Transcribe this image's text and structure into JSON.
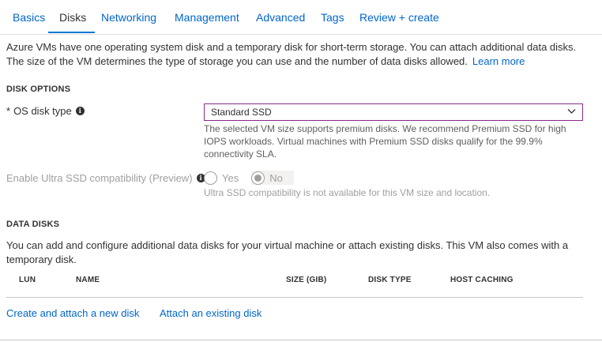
{
  "tabs": [
    {
      "label": "Basics",
      "active": false
    },
    {
      "label": "Disks",
      "active": true
    },
    {
      "label": "Networking",
      "active": false
    },
    {
      "label": "Management",
      "active": false
    },
    {
      "label": "Advanced",
      "active": false
    },
    {
      "label": "Tags",
      "active": false
    },
    {
      "label": "Review + create",
      "active": false
    }
  ],
  "intro": {
    "text": "Azure VMs have one operating system disk and a temporary disk for short-term storage. You can attach additional data disks. The size of the VM determines the type of storage you can use and the number of data disks allowed.",
    "learn_more": "Learn more"
  },
  "disk_options": {
    "heading": "DISK OPTIONS",
    "os_disk_type": {
      "required_mark": "*",
      "label": "OS disk type",
      "value": "Standard SSD",
      "help": "The selected VM size supports premium disks. We recommend Premium SSD for high IOPS workloads. Virtual machines with Premium SSD disks qualify for the 99.9% connectivity SLA."
    },
    "ultra_ssd": {
      "label": "Enable Ultra SSD compatibility (Preview)",
      "options": [
        "Yes",
        "No"
      ],
      "selected": "No",
      "help": "Ultra SSD compatibility is not available for this VM size and location."
    }
  },
  "data_disks": {
    "heading": "DATA DISKS",
    "description": "You can add and configure additional data disks for your virtual machine or attach existing disks. This VM also comes with a temporary disk.",
    "columns": [
      "LUN",
      "NAME",
      "SIZE (GIB)",
      "DISK TYPE",
      "HOST CACHING"
    ],
    "create_link": "Create and attach a new disk",
    "attach_link": "Attach an existing disk"
  },
  "colors": {
    "link": "#0066cc",
    "accent": "#0078d4",
    "select_border": "#8a2a8a"
  },
  "icons": {
    "info": "info-icon",
    "dropdown": "chevron-down-icon"
  }
}
